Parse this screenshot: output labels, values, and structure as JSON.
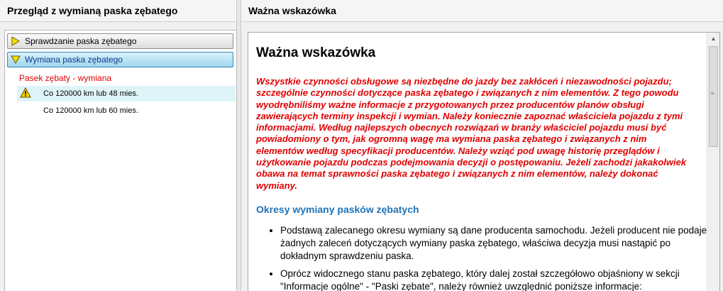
{
  "left_pane": {
    "title": "Przegląd z wymianą paska zębatego",
    "nodes": [
      {
        "label": "Sprawdzanie paska zębatego",
        "icon": "arrow-right-icon"
      },
      {
        "label": "Wymiana paska zębatego",
        "icon": "arrow-down-icon"
      }
    ],
    "section_title": "Pasek zębaty - wymiana",
    "items": [
      {
        "text": "Co 120000 km lub 48 mies.",
        "icon": "warning-icon",
        "selected": true
      },
      {
        "text": "Co 120000 km lub 60 mies.",
        "selected": false
      }
    ]
  },
  "right_pane": {
    "title": "Ważna wskazówka",
    "doc_title": "Ważna wskazówka",
    "warning_text": "Wszystkie czynności obsługowe są niezbędne do jazdy bez zakłóceń i niezawodności pojazdu; szczególnie czynności dotyczące paska zębatego i związanych z nim elementów. Z tego powodu wyodrębniliśmy ważne informacje z przygotowanych przez producentów planów obsługi zawierających terminy inspekcji i wymian. Należy koniecznie zapoznać właściciela pojazdu z tymi informacjami. Według najlepszych obecnych rozwiązań w branży właściciel pojazdu musi być powiadomiony o tym, jak ogromną wagę ma wymiana paska zębatego i związanych z nim elementów według specyfikacji producentów. Należy wziąć pod uwagę historię przeglądów i użytkowanie pojazdu podczas podejmowania decyzji o postępowaniu. Jeżeli zachodzi jakakolwiek obawa na temat sprawności paska zębatego i związanych z nim elementów, należy dokonać wymiany.",
    "subtitle": "Okresy wymiany pasków zębatych",
    "bullets": [
      "Podstawą zalecanego okresu wymiany są dane producenta samochodu. Jeżeli producent nie podaje żadnych zaleceń dotyczących wymiany paska zębatego, właściwa decyzja musi nastąpić po dokładnym sprawdzeniu paska.",
      "Oprócz widocznego stanu paska zębatego, który dalej został szczegółowo objaśniony w sekcji \"Informacje ogólne\" - \"Paski zębate\", należy również uwzględnić poniższe informacje:"
    ]
  },
  "colors": {
    "warning_red": "#e00000",
    "subtitle_blue": "#1f73b7",
    "selected_bg": "#dff4f8"
  }
}
